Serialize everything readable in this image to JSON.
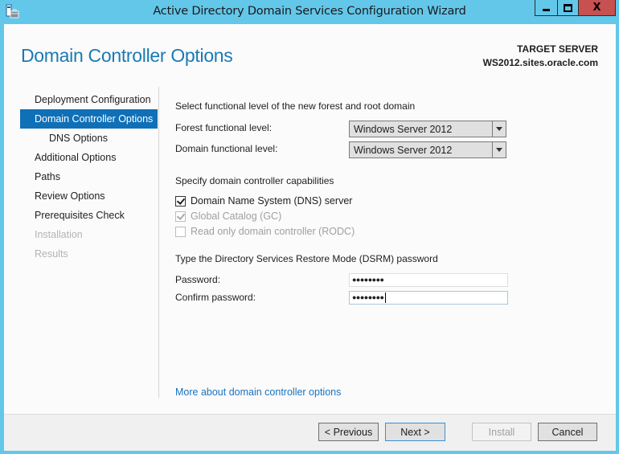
{
  "window": {
    "title": "Active Directory Domain Services Configuration Wizard",
    "controls": {
      "minimize": "minimize-icon",
      "maximize": "maximize-icon",
      "close": "X"
    }
  },
  "header": {
    "page_title": "Domain Controller Options",
    "target_server_label": "TARGET SERVER",
    "target_server_name": "WS2012.sites.oracle.com"
  },
  "nav": {
    "items": [
      {
        "label": "Deployment Configuration",
        "state": "normal"
      },
      {
        "label": "Domain Controller Options",
        "state": "active"
      },
      {
        "label": "DNS Options",
        "state": "sub"
      },
      {
        "label": "Additional Options",
        "state": "normal"
      },
      {
        "label": "Paths",
        "state": "normal"
      },
      {
        "label": "Review Options",
        "state": "normal"
      },
      {
        "label": "Prerequisites Check",
        "state": "normal"
      },
      {
        "label": "Installation",
        "state": "disabled"
      },
      {
        "label": "Results",
        "state": "disabled"
      }
    ]
  },
  "functional_level": {
    "heading": "Select functional level of the new forest and root domain",
    "forest_label": "Forest functional level:",
    "forest_value": "Windows Server 2012",
    "domain_label": "Domain functional level:",
    "domain_value": "Windows Server 2012"
  },
  "capabilities": {
    "heading": "Specify domain controller capabilities",
    "options": [
      {
        "label": "Domain Name System (DNS) server",
        "checked": true,
        "enabled": true
      },
      {
        "label": "Global Catalog (GC)",
        "checked": true,
        "enabled": false
      },
      {
        "label": "Read only domain controller (RODC)",
        "checked": false,
        "enabled": false
      }
    ]
  },
  "dsrm": {
    "heading": "Type the Directory Services Restore Mode (DSRM) password",
    "password_label": "Password:",
    "password_value": "●●●●●●●●",
    "confirm_label": "Confirm password:",
    "confirm_value": "●●●●●●●●"
  },
  "link": {
    "more_options": "More about domain controller options"
  },
  "footer": {
    "previous": "< Previous",
    "next": "Next >",
    "install": "Install",
    "cancel": "Cancel"
  },
  "colors": {
    "window_frame": "#63c7ea",
    "accent_title": "#1a7ab3",
    "nav_active": "#0f70b8",
    "close_button": "#c75050",
    "link": "#1a72c0"
  }
}
